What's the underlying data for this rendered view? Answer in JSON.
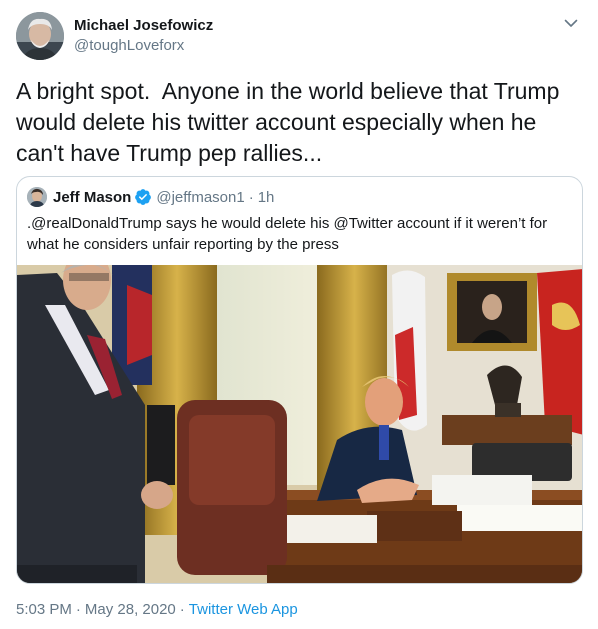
{
  "author": {
    "display_name": "Michael Josefowicz",
    "handle": "@toughLoveforx"
  },
  "tweet": {
    "text": "A bright spot.  Anyone in the world believe that Trump would delete his twitter account especially when he can't have Trump pep rallies..."
  },
  "quoted": {
    "display_name": "Jeff Mason",
    "handle": "@jeffmason1",
    "separator": "·",
    "time": "1h",
    "text": ".@realDonaldTrump says he would delete his @Twitter account if it weren’t for what he considers unfair reporting by the press",
    "verified_color": "#1da1f2"
  },
  "footer": {
    "time": "5:03 PM",
    "separator": "·",
    "date": "May 28, 2020",
    "source": "Twitter Web App"
  },
  "icons": {
    "menu": "chevron-down-icon",
    "verified": "verified-badge-icon"
  },
  "colors": {
    "text": "#14171a",
    "muted": "#657786",
    "link": "#1b95e0",
    "border": "#ccd6dd"
  }
}
